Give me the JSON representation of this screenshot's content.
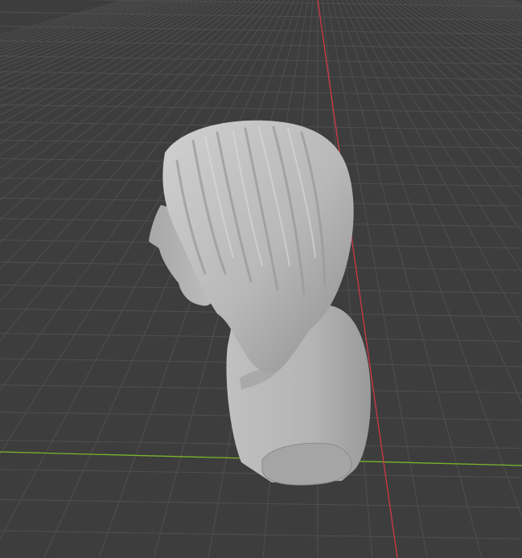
{
  "viewport": {
    "mode": "3d-viewport",
    "background_color": "#3d3d3d",
    "grid_color": "#4f4f4f",
    "x_axis_color": "#d23a45",
    "y_axis_color": "#79b52c"
  },
  "scene": {
    "objects": [
      {
        "name": "sculpted-bust",
        "shading": "solid",
        "material_color": "#b9b9b9",
        "selected": false
      }
    ]
  }
}
